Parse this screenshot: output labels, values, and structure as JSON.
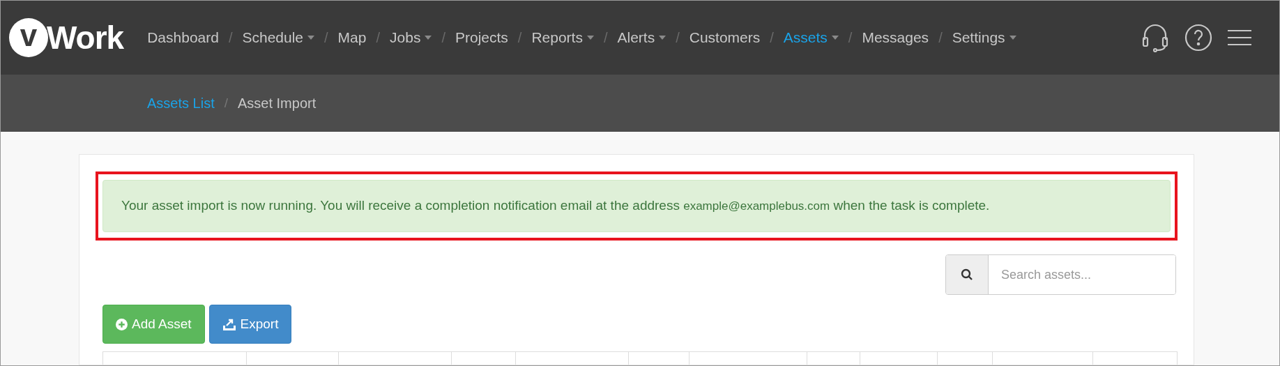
{
  "logo": {
    "text": "Work",
    "mark": "v"
  },
  "nav": [
    {
      "label": "Dashboard",
      "selected": false,
      "dropdown": false
    },
    {
      "label": "Schedule",
      "selected": false,
      "dropdown": true
    },
    {
      "label": "Map",
      "selected": false,
      "dropdown": false
    },
    {
      "label": "Jobs",
      "selected": false,
      "dropdown": true
    },
    {
      "label": "Projects",
      "selected": false,
      "dropdown": false
    },
    {
      "label": "Reports",
      "selected": false,
      "dropdown": true
    },
    {
      "label": "Alerts",
      "selected": false,
      "dropdown": true
    },
    {
      "label": "Customers",
      "selected": false,
      "dropdown": false
    },
    {
      "label": "Assets",
      "selected": true,
      "dropdown": true
    },
    {
      "label": "Messages",
      "selected": false,
      "dropdown": false
    },
    {
      "label": "Settings",
      "selected": false,
      "dropdown": true
    }
  ],
  "nav_separator": "/",
  "breadcrumb": [
    {
      "label": "Assets List",
      "kind": "link"
    },
    {
      "label": "Asset Import",
      "kind": "current"
    }
  ],
  "breadcrumb_separator": "/",
  "alert": {
    "message": "Your asset import is now running. You will receive a completion notification email at the address",
    "email": "example@examplebus.com",
    "suffix": "when the task is complete."
  },
  "search": {
    "placeholder": "Search assets..."
  },
  "buttons": [
    {
      "label": "Add Asset",
      "kind": "add"
    },
    {
      "label": "Export",
      "kind": "export"
    }
  ]
}
